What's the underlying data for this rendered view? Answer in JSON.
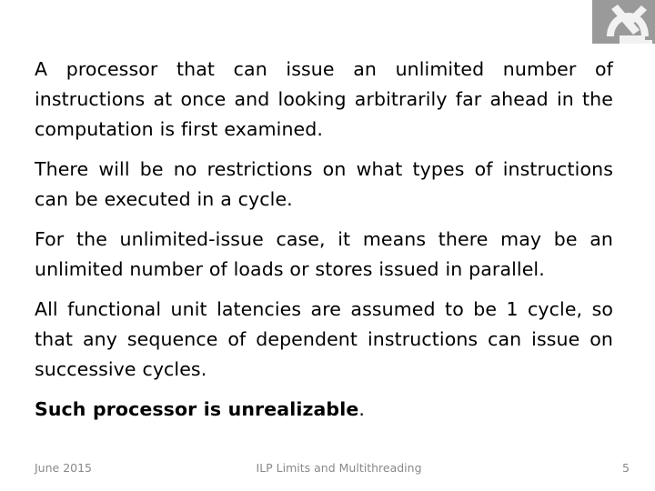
{
  "slide": {
    "logo": {
      "icon": "microscope-icon",
      "background_color": "#9a9a9a",
      "glyph_color": "#f2f2f2"
    },
    "body": {
      "text_color": "#000000",
      "paragraphs": [
        {
          "id": "paragraph-1",
          "text": "A processor that can issue an unlimited number of instructions at once and looking arbitrarily far ahead in the computation is first examined.",
          "bold": false,
          "justify": true
        },
        {
          "id": "paragraph-2",
          "text": "There will be no restrictions on what types of instructions can be executed in a cycle.",
          "bold": false,
          "justify": true
        },
        {
          "id": "paragraph-3",
          "text": "For the unlimited-issue case, it means there may be an unlimited number of loads or stores issued in parallel.",
          "bold": false,
          "justify": true
        },
        {
          "id": "paragraph-4",
          "text": "All functional unit latencies are assumed to be 1 cycle, so that any sequence of dependent instructions can issue on successive cycles.",
          "bold": false,
          "justify": true
        }
      ],
      "conclusion": {
        "id": "paragraph-5",
        "bold_text": "Such processor is unrealizable",
        "trailing_text": ".",
        "bold": true
      }
    },
    "footer": {
      "date": "June 2015",
      "title": "ILP Limits and Multithreading",
      "page_number": "5",
      "text_color": "#898989"
    }
  }
}
